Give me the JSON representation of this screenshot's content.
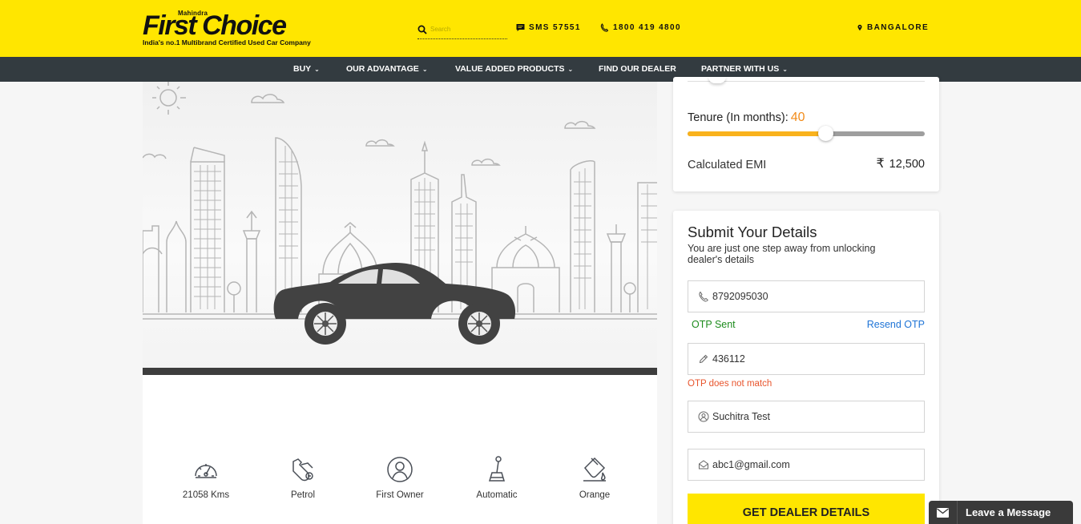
{
  "header": {
    "logo_small": "Mahindra",
    "logo_main": "First Choice",
    "logo_tagline": "India's no.1 Multibrand Certified Used Car Company",
    "search_placeholder": "Search",
    "sms": "SMS 57551",
    "phone": "1800 419 4800",
    "city": "BANGALORE"
  },
  "nav": {
    "items": [
      {
        "label": "BUY",
        "dropdown": true
      },
      {
        "label": "OUR ADVANTAGE",
        "dropdown": true
      },
      {
        "label": "VALUE ADDED PRODUCTS",
        "dropdown": true
      },
      {
        "label": "FIND OUR DEALER",
        "dropdown": false
      },
      {
        "label": "PARTNER WITH US",
        "dropdown": true
      }
    ],
    "chevron": "⌄"
  },
  "specs": [
    {
      "icon": "speedometer-icon",
      "label": "21058 Kms"
    },
    {
      "icon": "fuel-pump-icon",
      "label": "Petrol"
    },
    {
      "icon": "owner-icon",
      "label": "First Owner"
    },
    {
      "icon": "gear-shift-icon",
      "label": "Automatic"
    },
    {
      "icon": "paint-bucket-icon",
      "label": "Orange"
    }
  ],
  "emi": {
    "tenure_label": "Tenure (In months):",
    "tenure_value": "40",
    "tenure_fraction": 0.58,
    "calc_label": "Calculated EMI",
    "currency": "₹",
    "calc_value": "12,500"
  },
  "details": {
    "title": "Submit Your Details",
    "subtitle": "You are just one step away from unlocking dealer's details",
    "phone_value": "8792095030",
    "otp_sent": "OTP Sent",
    "resend": "Resend OTP",
    "otp_value": "436112",
    "otp_error": "OTP does not match",
    "name_value": "Suchitra Test",
    "email_value": "abc1@gmail.com",
    "submit": "GET DEALER DETAILS"
  },
  "chat": {
    "label": "Leave a Message"
  },
  "colors": {
    "brand_yellow": "#ffe600",
    "nav_dark": "#333b40",
    "accent_orange": "#f28c1b",
    "success": "#1e8c1e",
    "link": "#1f74d6",
    "error": "#e8542c"
  }
}
